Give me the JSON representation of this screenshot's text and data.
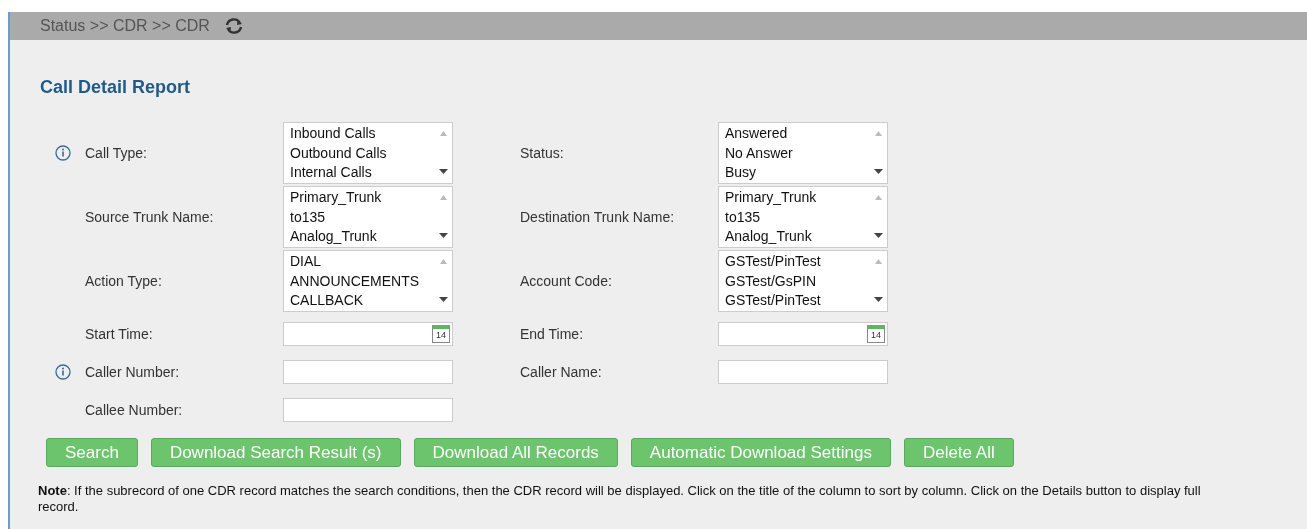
{
  "breadcrumb": "Status >> CDR >> CDR",
  "title": "Call Detail Report",
  "rows": [
    {
      "left": {
        "label": "Call Type:",
        "info": true,
        "kind": "listbox",
        "options": [
          "Inbound Calls",
          "Outbound Calls",
          "Internal Calls"
        ]
      },
      "right": {
        "label": "Status:",
        "info": false,
        "kind": "listbox",
        "options": [
          "Answered",
          "No Answer",
          "Busy"
        ]
      }
    },
    {
      "left": {
        "label": "Source Trunk Name:",
        "info": false,
        "kind": "listbox",
        "options": [
          "Primary_Trunk",
          "to135",
          "Analog_Trunk"
        ]
      },
      "right": {
        "label": "Destination Trunk Name:",
        "info": false,
        "kind": "listbox",
        "options": [
          "Primary_Trunk",
          "to135",
          "Analog_Trunk"
        ]
      }
    },
    {
      "left": {
        "label": "Action Type:",
        "info": false,
        "kind": "listbox",
        "options": [
          "DIAL",
          "ANNOUNCEMENTS",
          "CALLBACK"
        ]
      },
      "right": {
        "label": "Account Code:",
        "info": false,
        "kind": "listbox",
        "options": [
          "GSTest/PinTest",
          "GSTest/GsPIN",
          "GSTest/PinTest"
        ]
      }
    },
    {
      "left": {
        "label": "Start Time:",
        "info": false,
        "kind": "date",
        "calendar_day": "14"
      },
      "right": {
        "label": "End Time:",
        "info": false,
        "kind": "date",
        "calendar_day": "14"
      }
    },
    {
      "left": {
        "label": "Caller Number:",
        "info": true,
        "kind": "text"
      },
      "right": {
        "label": "Caller Name:",
        "info": false,
        "kind": "text"
      }
    },
    {
      "left": {
        "label": "Callee Number:",
        "info": false,
        "kind": "text"
      }
    }
  ],
  "buttons": [
    "Search",
    "Download Search Result (s)",
    "Download All Records",
    "Automatic Download Settings",
    "Delete All"
  ],
  "note": "**Note**: If the subrecord of one CDR record matches the search conditions, then the CDR record will be displayed. Click on the title of the column to sort by column. Click on the Details button to display full record."
}
